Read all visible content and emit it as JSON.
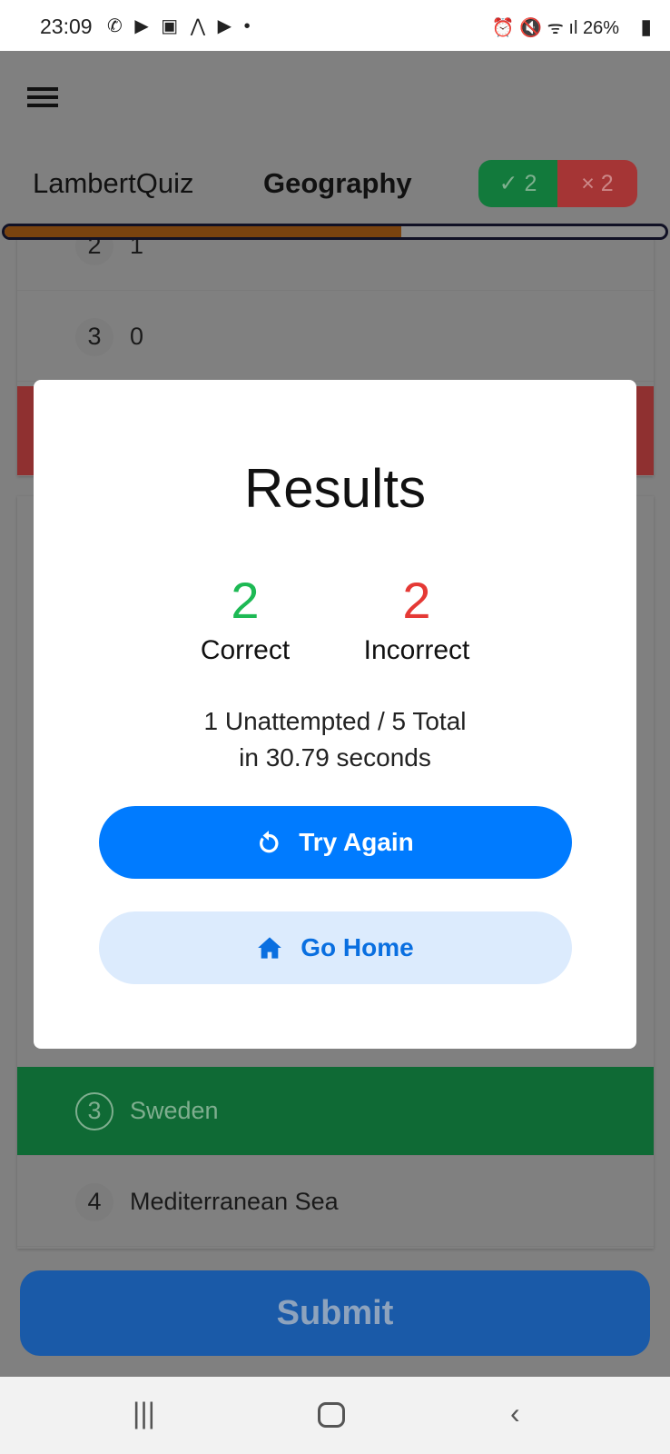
{
  "status_bar": {
    "time": "23:09",
    "battery": "26%"
  },
  "header": {
    "brand": "LambertQuiz",
    "category": "Geography",
    "correct_count": "✓ 2",
    "incorrect_count": "× 2",
    "progress": 0.6
  },
  "background": {
    "card1_rows": [
      {
        "num": "2",
        "text": "1"
      },
      {
        "num": "3",
        "text": "0"
      }
    ],
    "card2_rows": [
      {
        "num": "3",
        "text": "Sweden",
        "state": "correct"
      },
      {
        "num": "4",
        "text": "Mediterranean Sea"
      }
    ],
    "submit": "Submit"
  },
  "modal": {
    "title": "Results",
    "correct_value": "2",
    "correct_label": "Correct",
    "incorrect_value": "2",
    "incorrect_label": "Incorrect",
    "summary_line1": "1 Unattempted / 5 Total",
    "summary_line2": "in 30.79 seconds",
    "try_again": "Try Again",
    "go_home": "Go Home",
    "colors": {
      "correct": "#1db954",
      "incorrect": "#e53935",
      "primary": "#007bff"
    }
  }
}
